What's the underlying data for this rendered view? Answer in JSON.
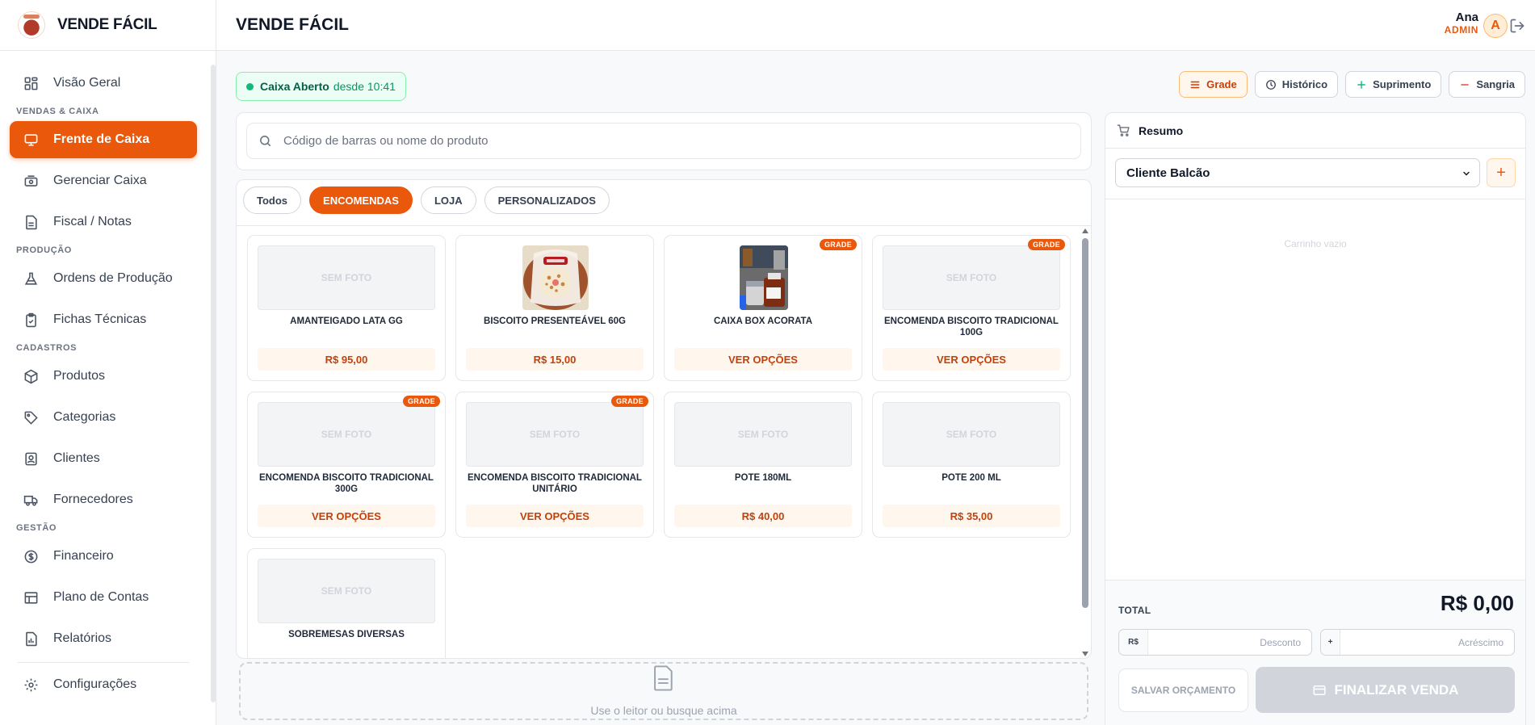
{
  "brand": {
    "name": "VENDE FÁCIL"
  },
  "header": {
    "title": "VENDE FÁCIL",
    "user_name": "Ana",
    "user_role": "ADMIN",
    "avatar_letter": "A"
  },
  "sidebar": {
    "items": [
      {
        "label": "Visão Geral",
        "icon": "dashboard-icon"
      },
      {
        "section": "VENDAS & CAIXA"
      },
      {
        "label": "Frente de Caixa",
        "icon": "monitor-icon",
        "active": true
      },
      {
        "label": "Gerenciar Caixa",
        "icon": "cash-register-icon"
      },
      {
        "label": "Fiscal / Notas",
        "icon": "document-icon"
      },
      {
        "section": "PRODUÇÃO"
      },
      {
        "label": "Ordens de Produção",
        "icon": "flask-icon"
      },
      {
        "label": "Fichas Técnicas",
        "icon": "clipboard-check-icon"
      },
      {
        "section": "CADASTROS"
      },
      {
        "label": "Produtos",
        "icon": "box-icon"
      },
      {
        "label": "Categorias",
        "icon": "tag-icon"
      },
      {
        "label": "Clientes",
        "icon": "contact-icon"
      },
      {
        "label": "Fornecedores",
        "icon": "truck-icon"
      },
      {
        "section": "GESTÃO"
      },
      {
        "label": "Financeiro",
        "icon": "dollar-circle-icon"
      },
      {
        "label": "Plano de Contas",
        "icon": "table-icon"
      },
      {
        "label": "Relatórios",
        "icon": "report-icon"
      },
      {
        "label": "Configurações",
        "icon": "gear-icon"
      }
    ]
  },
  "status": {
    "label": "Caixa Aberto",
    "since": "desde 10:41",
    "color": "#10b981"
  },
  "actions": {
    "grade": "Grade",
    "historico": "Histórico",
    "suprimento": "Suprimento",
    "sangria": "Sangria"
  },
  "search": {
    "placeholder": "Código de barras ou nome do produto"
  },
  "filters": [
    {
      "label": "Todos",
      "active": false
    },
    {
      "label": "ENCOMENDAS",
      "active": true
    },
    {
      "label": "LOJA",
      "active": false
    },
    {
      "label": "PERSONALIZADOS",
      "active": false
    }
  ],
  "products": [
    {
      "name": "AMANTEIGADO LATA GG",
      "price": "R$ 95,00",
      "photo": "none",
      "badge": ""
    },
    {
      "name": "BISCOITO PRESENTEÁVEL 60G",
      "price": "R$ 15,00",
      "photo": "cookie-bag",
      "badge": ""
    },
    {
      "name": "CAIXA BOX ACORATA",
      "price": "VER OPÇÕES",
      "photo": "box-jar",
      "badge": "GRADE"
    },
    {
      "name": "ENCOMENDA BISCOITO TRADICIONAL 100G",
      "price": "VER OPÇÕES",
      "photo": "none",
      "badge": "GRADE"
    },
    {
      "name": "ENCOMENDA BISCOITO TRADICIONAL 300G",
      "price": "VER OPÇÕES",
      "photo": "none",
      "badge": "GRADE"
    },
    {
      "name": "ENCOMENDA BISCOITO TRADICIONAL UNITÁRIO",
      "price": "VER OPÇÕES",
      "photo": "none",
      "badge": "GRADE"
    },
    {
      "name": "POTE 180ML",
      "price": "R$ 40,00",
      "photo": "none",
      "badge": ""
    },
    {
      "name": "POTE 200 ML",
      "price": "R$ 35,00",
      "photo": "none",
      "badge": ""
    },
    {
      "name": "SOBREMESAS DIVERSAS",
      "price": "",
      "photo": "none",
      "badge": ""
    }
  ],
  "no_photo_label": "SEM FOTO",
  "scanner": {
    "text": "Use o leitor ou busque acima"
  },
  "summary": {
    "title": "Resumo",
    "client": "Cliente Balcão",
    "add_label": "+",
    "empty": "Carrinho vazio",
    "total_label": "TOTAL",
    "total_value": "R$ 0,00",
    "discount_prefix": "R$",
    "discount_placeholder": "Desconto",
    "surcharge_prefix": "+",
    "surcharge_placeholder": "Acréscimo",
    "save_label": "SALVAR ORÇAMENTO",
    "finish_label": "FINALIZAR VENDA"
  },
  "colors": {
    "accent": "#ea580c",
    "accent_soft": "#fff7ed",
    "success": "#10b981"
  }
}
